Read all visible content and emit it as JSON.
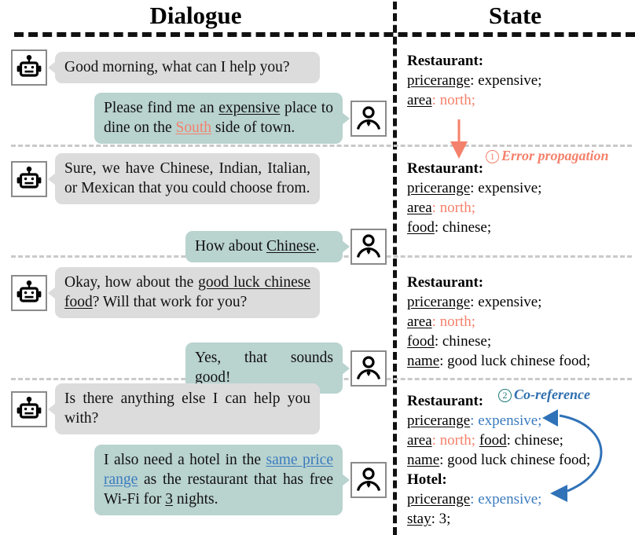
{
  "headers": {
    "dialogue": "Dialogue",
    "state": "State"
  },
  "colors": {
    "system_bubble": "#dcdcdc",
    "user_bubble": "#b9d3cf",
    "error_accent": "#f4816b",
    "coref_accent": "#3a7bbf",
    "circle_two": "#1f7a7a",
    "divider": "#111111",
    "group_separator": "#c9c9c9"
  },
  "icons": {
    "system": "robot-icon",
    "user": "person-icon"
  },
  "turns": [
    {
      "system": {
        "full": "Good morning, what can I help you?",
        "parts": [
          {
            "t": "Good morning, what can I help you?",
            "s": "plain"
          }
        ]
      },
      "user": {
        "full": "Please find me an expensive place to dine on the South side of town.",
        "parts": [
          {
            "t": "Please find me an ",
            "s": "plain"
          },
          {
            "t": "expensive",
            "s": "underline"
          },
          {
            "t": " place to dine on the ",
            "s": "plain"
          },
          {
            "t": "South",
            "s": "underline-red"
          },
          {
            "t": " side of town.",
            "s": "plain"
          }
        ]
      }
    },
    {
      "system": {
        "full": "Sure, we have Chinese, Indian, Italian, or Mexican that you could choose from.",
        "parts": [
          {
            "t": "Sure, we have Chinese, Indian, Italian, or Mexican that you could choose from.",
            "s": "plain"
          }
        ]
      },
      "user": {
        "full": "How about Chinese.",
        "parts": [
          {
            "t": "How about ",
            "s": "plain"
          },
          {
            "t": "Chinese",
            "s": "underline"
          },
          {
            "t": ".",
            "s": "plain"
          }
        ]
      }
    },
    {
      "system": {
        "full": "Okay, how about the good luck chinese food? Will that work for you?",
        "parts": [
          {
            "t": "Okay, how about the ",
            "s": "plain"
          },
          {
            "t": "good luck chinese food",
            "s": "underline"
          },
          {
            "t": "? Will that work for you?",
            "s": "plain"
          }
        ]
      },
      "user": {
        "full": "Yes, that sounds good!",
        "parts": [
          {
            "t": "Yes, that sounds good!",
            "s": "plain"
          }
        ]
      }
    },
    {
      "system": {
        "full": "Is there anything else I can help you with?",
        "parts": [
          {
            "t": "Is there anything else I can help you with?",
            "s": "plain"
          }
        ]
      },
      "user": {
        "full": "I also need a hotel in the same price range as the restaurant that has free Wi-Fi for 3 nights.",
        "parts": [
          {
            "t": "I also need a hotel in the ",
            "s": "plain"
          },
          {
            "t": "same price range",
            "s": "underline-blue"
          },
          {
            "t": " as the restaurant that has free Wi-Fi for ",
            "s": "plain"
          },
          {
            "t": "3",
            "s": "underline"
          },
          {
            "t": " nights.",
            "s": "plain"
          }
        ]
      }
    }
  ],
  "states": [
    {
      "domain": "Restaurant:",
      "lines": [
        [
          {
            "k": "pricerange",
            "v": ": expensive;",
            "c": "black"
          }
        ],
        [
          {
            "k": "area",
            "v": ": north;",
            "c": "red"
          }
        ]
      ]
    },
    {
      "domain": "Restaurant:",
      "lines": [
        [
          {
            "k": "pricerange",
            "v": ": expensive;",
            "c": "black"
          }
        ],
        [
          {
            "k": "area",
            "v": ": north;",
            "c": "red"
          }
        ],
        [
          {
            "k": "food",
            "v": ": chinese;",
            "c": "black"
          }
        ]
      ]
    },
    {
      "domain": "Restaurant:",
      "lines": [
        [
          {
            "k": "pricerange",
            "v": ": expensive;",
            "c": "black"
          }
        ],
        [
          {
            "k": "area",
            "v": ": north;",
            "c": "red"
          }
        ],
        [
          {
            "k": "food",
            "v": ": chinese;",
            "c": "black"
          }
        ],
        [
          {
            "k": "name",
            "v": ": good luck chinese food;",
            "c": "black"
          }
        ]
      ]
    },
    {
      "domain": "Restaurant:",
      "lines": [
        [
          {
            "k": "pricerange",
            "v": ": expensive;",
            "c": "blue"
          }
        ],
        [
          {
            "k": "area",
            "v": ": north;",
            "c": "red"
          },
          {
            "k": "food",
            "v": ": chinese;",
            "c": "black"
          }
        ],
        [
          {
            "k": "name",
            "v": ": good luck chinese food;",
            "c": "black"
          }
        ]
      ],
      "domain2": "Hotel:",
      "lines2": [
        [
          {
            "k": "pricerange",
            "v": ": expensive;",
            "c": "blue"
          }
        ],
        [
          {
            "k": "stay",
            "v": ": 3;",
            "c": "black"
          }
        ]
      ]
    }
  ],
  "annotations": {
    "error": {
      "number": "1",
      "label": "Error propagation"
    },
    "coref": {
      "number": "2",
      "label": "Co-reference"
    }
  }
}
